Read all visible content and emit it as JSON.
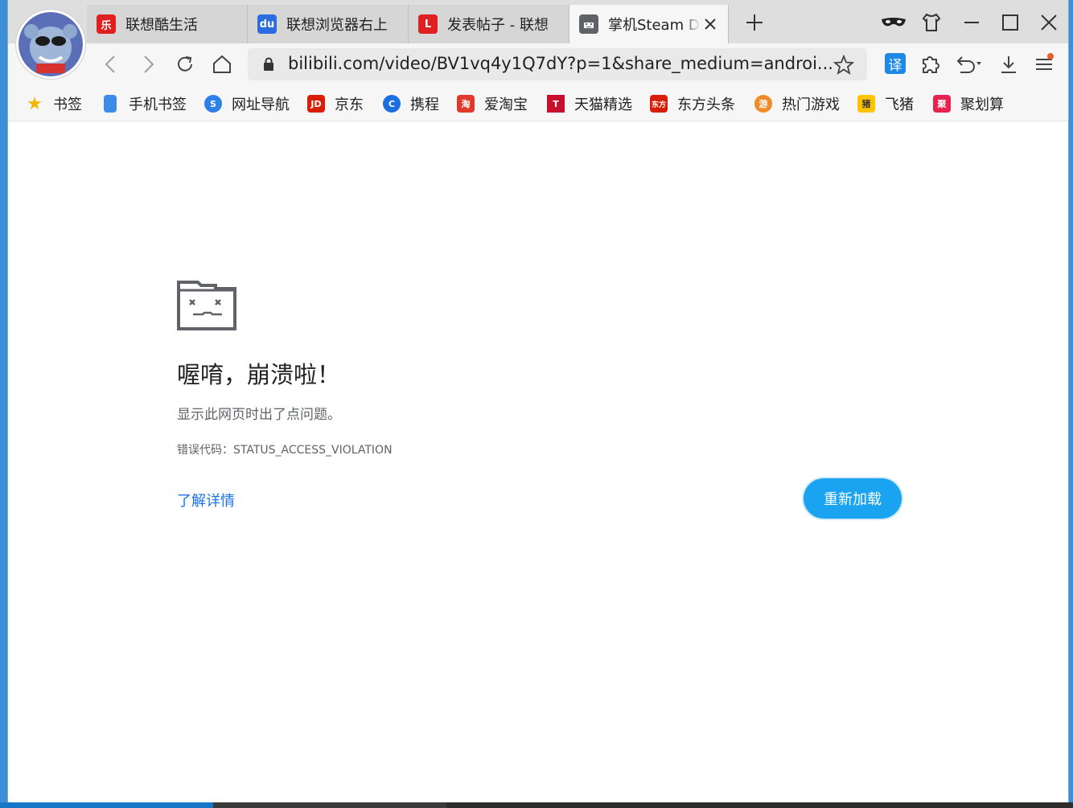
{
  "tabs": [
    {
      "label": "联想酷生活",
      "fav_text": "乐",
      "fav_color": "#e02020"
    },
    {
      "label": "联想浏览器右上",
      "fav_text": "du",
      "fav_color": "#2b6de0"
    },
    {
      "label": "发表帖子 - 联想",
      "fav_text": "L",
      "fav_color": "#e02020"
    },
    {
      "label": "掌机Steam D",
      "fav_text": "",
      "fav_color": "#5f6368"
    }
  ],
  "address_bar": {
    "url": "bilibili.com/video/BV1vq4y1Q7dY?p=1&share_medium=androi..."
  },
  "bookmarks": [
    {
      "label": "书签",
      "icon": "star-icon",
      "color": "#f5b400",
      "text": "★"
    },
    {
      "label": "手机书签",
      "icon": "phone-icon",
      "color": "#3d8be8",
      "text": ""
    },
    {
      "label": "网址导航",
      "icon": "navigation-icon",
      "color": "#2f7fe8",
      "text": "S"
    },
    {
      "label": "京东",
      "icon": "jd-icon",
      "color": "#d81e06",
      "text": "JD"
    },
    {
      "label": "携程",
      "icon": "ctrip-icon",
      "color": "#1d6fe0",
      "text": "C"
    },
    {
      "label": "爱淘宝",
      "icon": "taobao-icon",
      "color": "#e03a2a",
      "text": "淘"
    },
    {
      "label": "天猫精选",
      "icon": "tmall-icon",
      "color": "#c8102e",
      "text": "T"
    },
    {
      "label": "东方头条",
      "icon": "dftt-icon",
      "color": "#d81e06",
      "text": "东方"
    },
    {
      "label": "热门游戏",
      "icon": "game-icon",
      "color": "#f08a24",
      "text": "游"
    },
    {
      "label": "飞猪",
      "icon": "fliggy-icon",
      "color": "#ffc300",
      "text": "猪"
    },
    {
      "label": "聚划算",
      "icon": "juhuasuan-icon",
      "color": "#e8224f",
      "text": "聚"
    }
  ],
  "crash": {
    "title": "喔唷，崩溃啦！",
    "description": "显示此网页时出了点问题。",
    "error_code": "错误代码：STATUS_ACCESS_VIOLATION",
    "learn_more": "了解详情",
    "reload": "重新加载"
  },
  "toolbar": {
    "translate_label": "译"
  },
  "colors": {
    "reload_button": "#1aa3f0",
    "link": "#1a73e8"
  }
}
